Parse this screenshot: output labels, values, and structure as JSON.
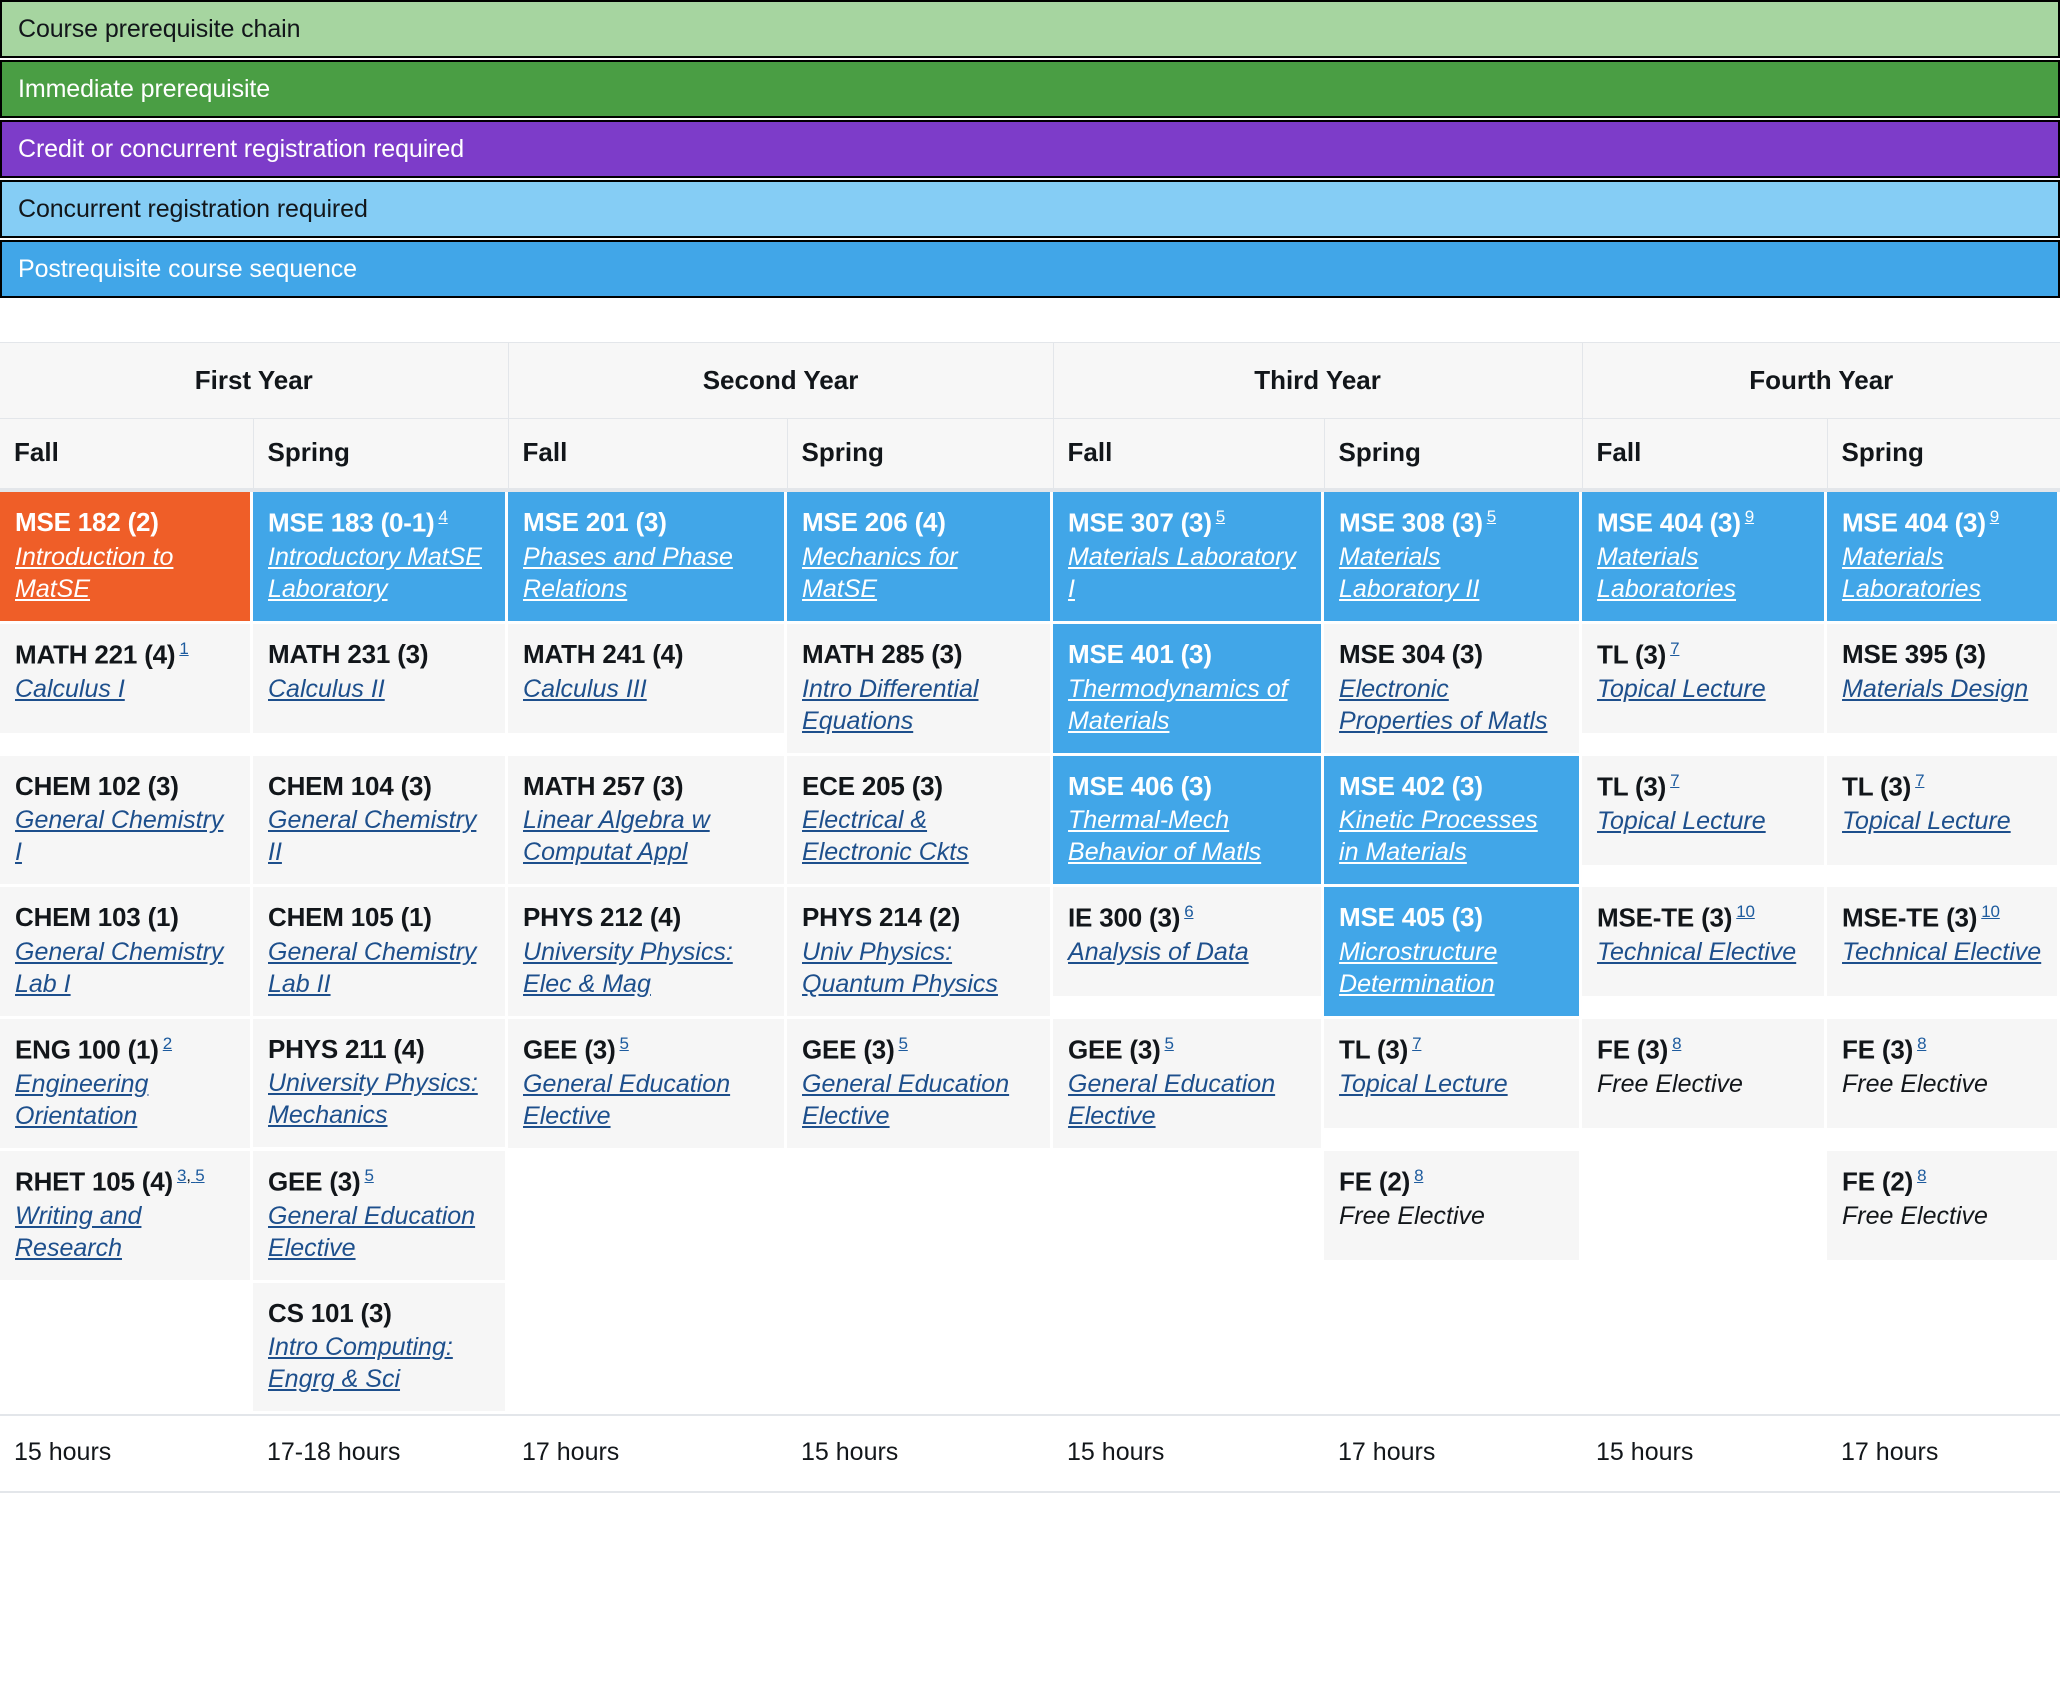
{
  "legend": {
    "items": [
      {
        "label": "Course prerequisite chain",
        "bg": "#a6d5a0",
        "fg": "#12161a"
      },
      {
        "label": "Immediate prerequisite",
        "bg": "#4a9e44",
        "fg": "#ffffff"
      },
      {
        "label": "Credit or concurrent registration required",
        "bg": "#7d3cc9",
        "fg": "#ffffff"
      },
      {
        "label": "Concurrent registration required",
        "bg": "#85cdf5",
        "fg": "#12161a"
      },
      {
        "label": "Postrequisite course sequence",
        "bg": "#41a6e8",
        "fg": "#ffffff"
      }
    ]
  },
  "colors": {
    "highlight_blue": "#41a6e8",
    "highlight_orange": "#ef5e28",
    "cell_gray": "#f6f6f6",
    "link_blue": "#1d4f8c",
    "header_gray": "#f7f7f7"
  },
  "table": {
    "years": [
      "First Year",
      "Second Year",
      "Third Year",
      "Fourth Year"
    ],
    "terms": [
      "Fall",
      "Spring",
      "Fall",
      "Spring",
      "Fall",
      "Spring",
      "Fall",
      "Spring"
    ],
    "columns": [
      {
        "year": "First Year",
        "term": "Fall",
        "hours": "15 hours",
        "courses": [
          {
            "code": "MSE 182 (2)",
            "title": "Introduction to MatSE",
            "sup": "",
            "style": "orange",
            "link": true
          },
          {
            "code": "MATH 221 (4)",
            "title": "Calculus I",
            "sup": "1",
            "style": "plain",
            "link": true
          },
          {
            "code": "CHEM 102 (3)",
            "title": "General Chemistry I",
            "sup": "",
            "style": "plain",
            "link": true
          },
          {
            "code": "CHEM 103 (1)",
            "title": "General Chemistry Lab I",
            "sup": "",
            "style": "plain",
            "link": true
          },
          {
            "code": "ENG 100 (1)",
            "title": "Engineering Orientation",
            "sup": "2",
            "style": "plain",
            "link": true
          },
          {
            "code": "RHET 105 (4)",
            "title": "Writing and Research",
            "sup": "3, 5",
            "style": "plain",
            "link": true
          }
        ]
      },
      {
        "year": "First Year",
        "term": "Spring",
        "hours": "17-18 hours",
        "courses": [
          {
            "code": "MSE 183 (0-1)",
            "title": "Introductory MatSE Laboratory",
            "sup": "4",
            "style": "blue",
            "link": true
          },
          {
            "code": "MATH 231 (3)",
            "title": "Calculus II",
            "sup": "",
            "style": "plain",
            "link": true
          },
          {
            "code": "CHEM 104 (3)",
            "title": "General Chemistry II",
            "sup": "",
            "style": "plain",
            "link": true
          },
          {
            "code": "CHEM 105 (1)",
            "title": "General Chemistry Lab II",
            "sup": "",
            "style": "plain",
            "link": true
          },
          {
            "code": "PHYS 211 (4)",
            "title": "University Physics: Mechanics",
            "sup": "",
            "style": "plain",
            "link": true
          },
          {
            "code": "GEE (3)",
            "title": "General Education Elective",
            "sup": "5",
            "style": "plain",
            "link": true
          },
          {
            "code": "CS 101 (3)",
            "title": "Intro Computing: Engrg & Sci",
            "sup": "",
            "style": "plain",
            "link": true
          }
        ]
      },
      {
        "year": "Second Year",
        "term": "Fall",
        "hours": "17 hours",
        "courses": [
          {
            "code": "MSE 201 (3)",
            "title": "Phases and Phase Relations",
            "sup": "",
            "style": "blue",
            "link": true
          },
          {
            "code": "MATH 241 (4)",
            "title": "Calculus III",
            "sup": "",
            "style": "plain",
            "link": true
          },
          {
            "code": "MATH 257 (3)",
            "title": "Linear Algebra w Computat Appl",
            "sup": "",
            "style": "plain",
            "link": true
          },
          {
            "code": "PHYS 212 (4)",
            "title": "University Physics: Elec & Mag",
            "sup": "",
            "style": "plain",
            "link": true
          },
          {
            "code": "GEE (3)",
            "title": "General Education Elective",
            "sup": "5",
            "style": "plain",
            "link": true
          }
        ]
      },
      {
        "year": "Second Year",
        "term": "Spring",
        "hours": "15 hours",
        "courses": [
          {
            "code": "MSE 206 (4)",
            "title": "Mechanics for MatSE",
            "sup": "",
            "style": "blue",
            "link": true
          },
          {
            "code": "MATH 285 (3)",
            "title": "Intro Differential Equations",
            "sup": "",
            "style": "plain",
            "link": true
          },
          {
            "code": "ECE 205 (3)",
            "title": "Electrical & Electronic Ckts",
            "sup": "",
            "style": "plain",
            "link": true
          },
          {
            "code": "PHYS 214 (2)",
            "title": "Univ Physics: Quantum Physics",
            "sup": "",
            "style": "plain",
            "link": true
          },
          {
            "code": "GEE (3)",
            "title": "General Education Elective",
            "sup": "5",
            "style": "plain",
            "link": true
          }
        ]
      },
      {
        "year": "Third Year",
        "term": "Fall",
        "hours": "15 hours",
        "courses": [
          {
            "code": "MSE 307 (3)",
            "title": "Materials Laboratory I",
            "sup": "5",
            "style": "blue",
            "link": true
          },
          {
            "code": "MSE 401 (3)",
            "title": "Thermodynamics of Materials",
            "sup": "",
            "style": "blue",
            "link": true
          },
          {
            "code": "MSE 406 (3)",
            "title": "Thermal-Mech Behavior of Matls",
            "sup": "",
            "style": "blue",
            "link": true
          },
          {
            "code": "IE 300 (3)",
            "title": "Analysis of Data",
            "sup": "6",
            "style": "plain",
            "link": true
          },
          {
            "code": "GEE (3)",
            "title": "General Education Elective",
            "sup": "5",
            "style": "plain",
            "link": true
          }
        ]
      },
      {
        "year": "Third Year",
        "term": "Spring",
        "hours": "17 hours",
        "courses": [
          {
            "code": "MSE 308 (3)",
            "title": "Materials Laboratory II",
            "sup": "5",
            "style": "blue",
            "link": true
          },
          {
            "code": "MSE 304 (3)",
            "title": "Electronic Properties of Matls",
            "sup": "",
            "style": "plain",
            "link": true
          },
          {
            "code": "MSE 402 (3)",
            "title": "Kinetic Processes in Materials",
            "sup": "",
            "style": "blue",
            "link": true
          },
          {
            "code": "MSE 405 (3)",
            "title": "Microstructure Determination",
            "sup": "",
            "style": "blue",
            "link": true
          },
          {
            "code": "TL (3)",
            "title": "Topical Lecture",
            "sup": "7",
            "style": "plain",
            "link": true
          },
          {
            "code": "FE (2)",
            "title": "Free Elective",
            "sup": "8",
            "style": "plain",
            "link": false
          }
        ]
      },
      {
        "year": "Fourth Year",
        "term": "Fall",
        "hours": "15 hours",
        "courses": [
          {
            "code": "MSE 404 (3)",
            "title": "Materials Laboratories",
            "sup": "9",
            "style": "blue",
            "link": true
          },
          {
            "code": "TL (3)",
            "title": "Topical Lecture",
            "sup": "7",
            "style": "plain",
            "link": true
          },
          {
            "code": "TL (3)",
            "title": "Topical Lecture",
            "sup": "7",
            "style": "plain",
            "link": true
          },
          {
            "code": "MSE-TE (3)",
            "title": "Technical Elective",
            "sup": "10",
            "style": "plain",
            "link": true
          },
          {
            "code": "FE (3)",
            "title": "Free Elective",
            "sup": "8",
            "style": "plain",
            "link": false
          }
        ]
      },
      {
        "year": "Fourth Year",
        "term": "Spring",
        "hours": "17 hours",
        "courses": [
          {
            "code": "MSE 404 (3)",
            "title": "Materials Laboratories",
            "sup": "9",
            "style": "blue",
            "link": true
          },
          {
            "code": "MSE 395 (3)",
            "title": "Materials Design",
            "sup": "",
            "style": "plain",
            "link": true
          },
          {
            "code": "TL (3)",
            "title": "Topical Lecture",
            "sup": "7",
            "style": "plain",
            "link": true
          },
          {
            "code": "MSE-TE (3)",
            "title": "Technical Elective",
            "sup": "10",
            "style": "plain",
            "link": true
          },
          {
            "code": "FE (3)",
            "title": "Free Elective",
            "sup": "8",
            "style": "plain",
            "link": false
          },
          {
            "code": "FE (2)",
            "title": "Free Elective",
            "sup": "8",
            "style": "plain",
            "link": false
          }
        ]
      }
    ]
  }
}
